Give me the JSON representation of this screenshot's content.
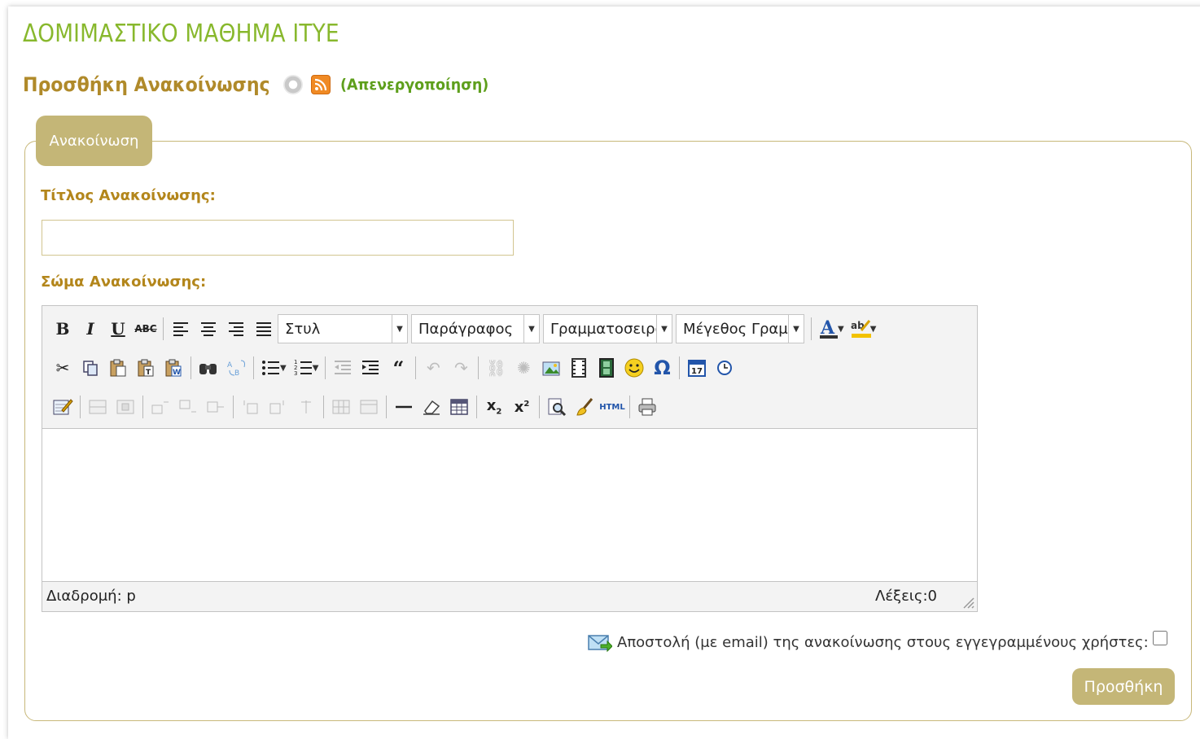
{
  "course": {
    "title": "ΔΟΜΙΜΑΣΤΙΚΟ ΜΑΘΗΜΑ ΙΤΥΕ"
  },
  "heading": {
    "title": "Προσθήκη Ανακοίνωσης",
    "deactivate_link": "(Απενεργοποίηση)",
    "icons": [
      "help-icon",
      "rss-icon"
    ]
  },
  "form": {
    "legend": "Ανακοίνωση",
    "title_label": "Τίτλος Ανακοίνωσης:",
    "title_value": "",
    "body_label": "Σώμα Ανακοίνωσης:",
    "notify_label": "Αποστολή (με email) της ανακοίνωσης στους εγγεγραμμένους χρήστες:",
    "notify_checked": false,
    "submit_label": "Προσθήκη"
  },
  "editor": {
    "style_select": "Στυλ",
    "format_select": "Παράγραφος",
    "font_select": "Γραμματοσειρά",
    "size_select": "Μέγεθος Γραμματοσειράς",
    "status_path": "Διαδρομή: p",
    "word_count": "Λέξεις:0"
  },
  "colors": {
    "course_title": "#88b82d",
    "heading": "#b08a2a",
    "label": "#b3861b",
    "accent": "#c4b677",
    "link": "#5e9f1c"
  }
}
